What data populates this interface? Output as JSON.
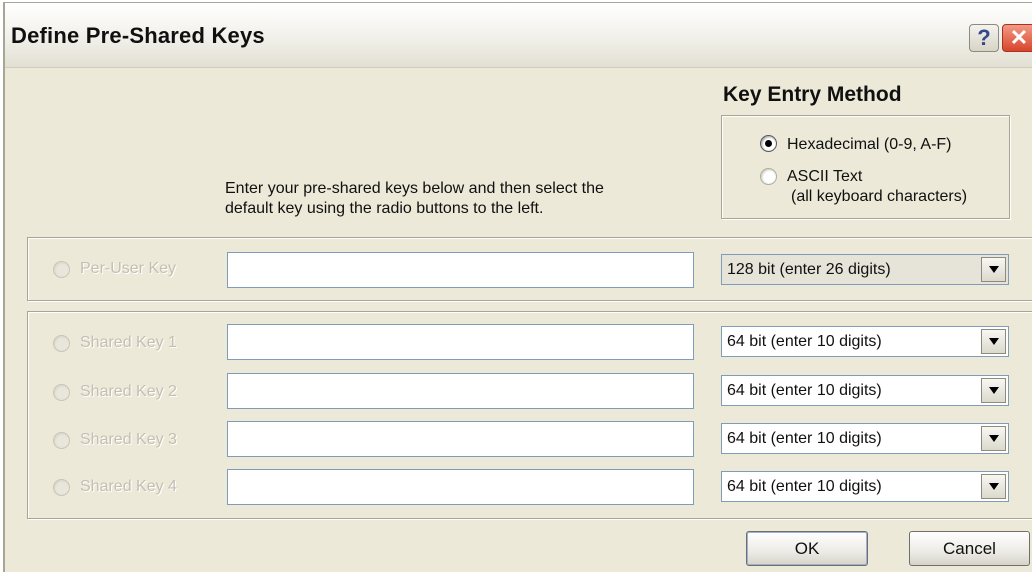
{
  "window": {
    "title": "Define Pre-Shared Keys",
    "help_glyph": "?",
    "close_glyph": "✕"
  },
  "key_entry": {
    "title": "Key Entry Method",
    "options": [
      {
        "label": "Hexadecimal (0-9, A-F)",
        "selected": true
      },
      {
        "label": "ASCII Text",
        "sublabel": "(all keyboard characters)",
        "selected": false
      }
    ]
  },
  "instructions": {
    "line1": "Enter your pre-shared keys below and then select the",
    "line2": "default key using the radio buttons to the left."
  },
  "per_user": {
    "label": "Per-User Key",
    "value": "",
    "size": "128 bit (enter 26 digits)"
  },
  "shared_keys": [
    {
      "label": "Shared Key 1",
      "value": "",
      "size": "64 bit (enter 10 digits)"
    },
    {
      "label": "Shared Key 2",
      "value": "",
      "size": "64 bit (enter 10 digits)"
    },
    {
      "label": "Shared Key 3",
      "value": "",
      "size": "64 bit (enter 10 digits)"
    },
    {
      "label": "Shared Key 4",
      "value": "",
      "size": "64 bit (enter 10 digits)"
    }
  ],
  "buttons": {
    "ok": "OK",
    "cancel": "Cancel"
  },
  "colors": {
    "dialog_bg": "#ece9d8",
    "disabled_text": "#c3c0b2",
    "field_border": "#7f9db9"
  }
}
